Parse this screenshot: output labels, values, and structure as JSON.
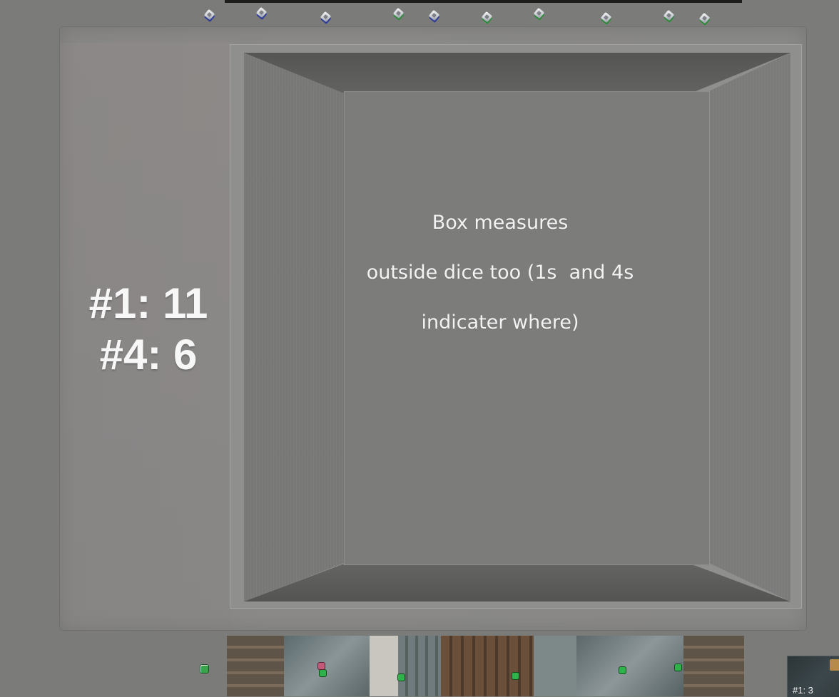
{
  "tray": {
    "note_lines": [
      "Box measures",
      "outside dice too (1s  and 4s",
      "indicater where)"
    ]
  },
  "counts": {
    "line1": "#1: 11",
    "line2": "#4: 6"
  },
  "mini_panel": {
    "label": "#1: 3"
  },
  "icons": {
    "top_dice": [
      "die-icon"
    ],
    "lone_die": "die-icon"
  },
  "colors": {
    "background": "#7b7c7a",
    "tray": "#888887",
    "floor": "#7c7c7b",
    "text": "#f3f3f3",
    "green_die": "#2fb24a",
    "blue_die_edge": "#2d3b99"
  }
}
